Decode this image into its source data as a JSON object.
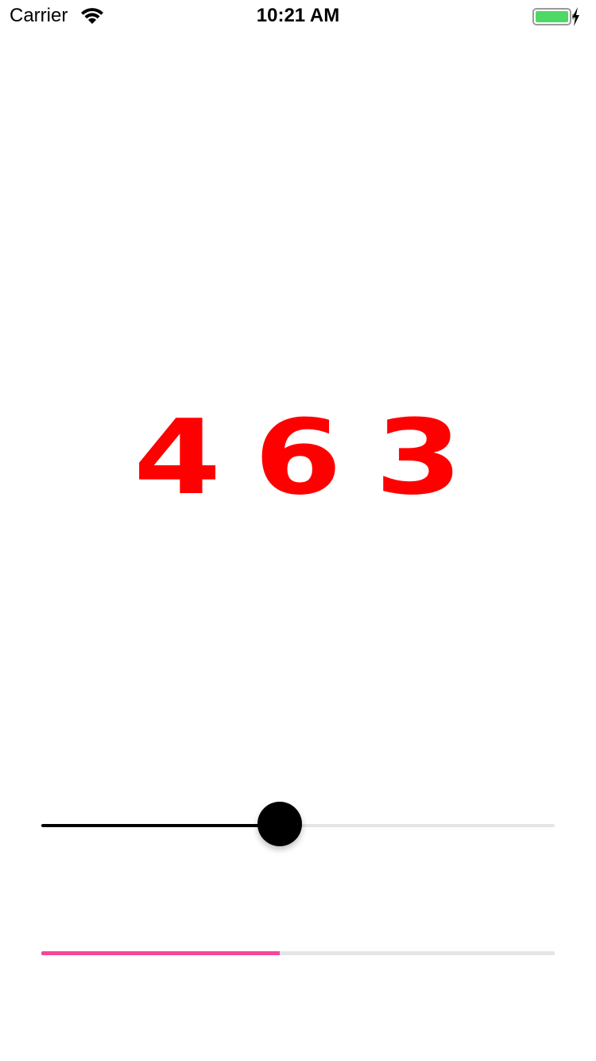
{
  "status_bar": {
    "carrier": "Carrier",
    "time": "10:21 AM",
    "wifi_icon": "wifi-icon",
    "battery_icon": "battery-charging-icon",
    "battery_color": "#4cd964"
  },
  "counter": {
    "value": "463",
    "color": "#ff0000"
  },
  "slider": {
    "value_fraction": 0.465,
    "fill_color": "#000000",
    "track_color": "#e5e5e5",
    "thumb_color": "#000000"
  },
  "progress": {
    "value_fraction": 0.465,
    "fill_color": "#f5479a",
    "track_color": "#e5e5e5"
  }
}
